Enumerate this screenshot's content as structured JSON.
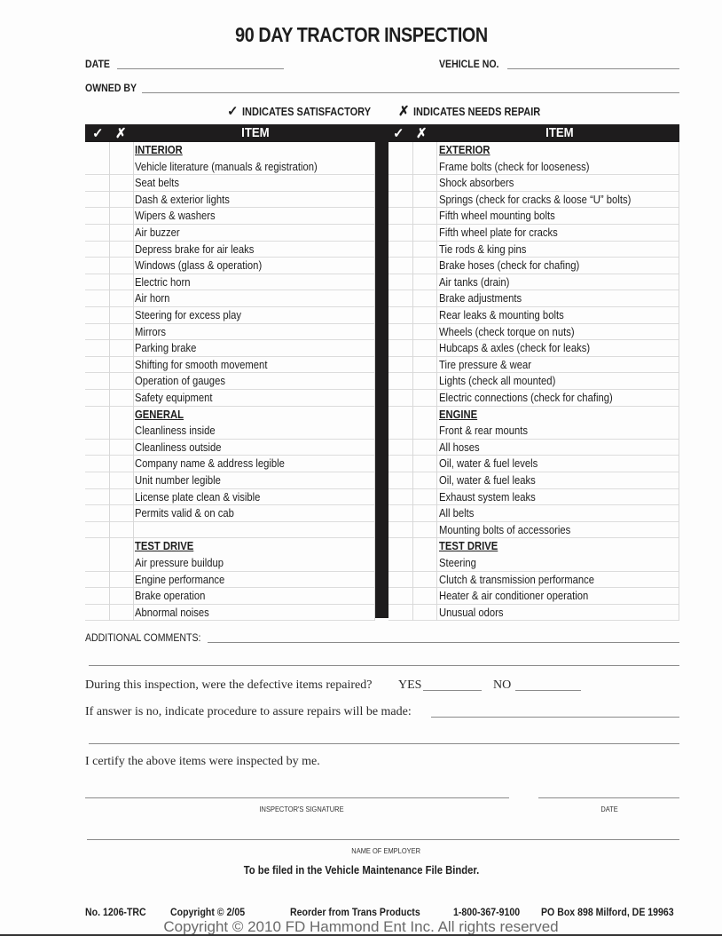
{
  "form": {
    "title": "90 DAY TRACTOR INSPECTION",
    "date_label": "DATE",
    "date_value": "",
    "vehicle_no_label": "VEHICLE NO.",
    "vehicle_no_value": "",
    "owned_by_label": "OWNED BY",
    "owned_by_value": ""
  },
  "legend": {
    "satisfactory_icon": "check-icon",
    "satisfactory_symbol": "✓",
    "satisfactory_label": "INDICATES SATISFACTORY",
    "repair_icon": "x-icon",
    "repair_symbol": "✗",
    "repair_label": "INDICATES NEEDS REPAIR"
  },
  "table": {
    "header": {
      "check_symbol": "✓",
      "x_symbol": "✗",
      "item_label": "ITEM"
    },
    "left_column": [
      {
        "text": "INTERIOR",
        "section": true
      },
      {
        "text": "Vehicle literature (manuals & registration)",
        "section": false
      },
      {
        "text": "Seat belts",
        "section": false
      },
      {
        "text": "Dash & exterior lights",
        "section": false
      },
      {
        "text": "Wipers & washers",
        "section": false
      },
      {
        "text": "Air buzzer",
        "section": false
      },
      {
        "text": "Depress brake for air leaks",
        "section": false
      },
      {
        "text": "Windows (glass & operation)",
        "section": false
      },
      {
        "text": "Electric horn",
        "section": false
      },
      {
        "text": "Air horn",
        "section": false
      },
      {
        "text": "Steering for excess play",
        "section": false
      },
      {
        "text": "Mirrors",
        "section": false
      },
      {
        "text": "Parking brake",
        "section": false
      },
      {
        "text": "Shifting for smooth movement",
        "section": false
      },
      {
        "text": "Operation of gauges",
        "section": false
      },
      {
        "text": "Safety equipment",
        "section": false
      },
      {
        "text": "GENERAL",
        "section": true
      },
      {
        "text": "Cleanliness inside",
        "section": false
      },
      {
        "text": "Cleanliness outside",
        "section": false
      },
      {
        "text": "Company name & address legible",
        "section": false
      },
      {
        "text": "Unit number legible",
        "section": false
      },
      {
        "text": "License plate clean & visible",
        "section": false
      },
      {
        "text": "Permits valid & on cab",
        "section": false
      },
      {
        "text": "",
        "section": false
      },
      {
        "text": "TEST DRIVE",
        "section": true
      },
      {
        "text": "Air pressure buildup",
        "section": false
      },
      {
        "text": "Engine performance",
        "section": false
      },
      {
        "text": "Brake operation",
        "section": false
      },
      {
        "text": "Abnormal noises",
        "section": false
      }
    ],
    "right_column": [
      {
        "text": "EXTERIOR",
        "section": true
      },
      {
        "text": "Frame bolts (check for looseness)",
        "section": false
      },
      {
        "text": "Shock absorbers",
        "section": false
      },
      {
        "text": "Springs (check for cracks & loose “U” bolts)",
        "section": false
      },
      {
        "text": "Fifth wheel mounting bolts",
        "section": false
      },
      {
        "text": "Fifth wheel plate for cracks",
        "section": false
      },
      {
        "text": "Tie rods & king pins",
        "section": false
      },
      {
        "text": "Brake hoses (check for chafing)",
        "section": false
      },
      {
        "text": "Air tanks (drain)",
        "section": false
      },
      {
        "text": "Brake adjustments",
        "section": false
      },
      {
        "text": "Rear leaks & mounting bolts",
        "section": false
      },
      {
        "text": "Wheels (check torque on nuts)",
        "section": false
      },
      {
        "text": "Hubcaps & axles (check for leaks)",
        "section": false
      },
      {
        "text": "Tire pressure & wear",
        "section": false
      },
      {
        "text": "Lights (check all mounted)",
        "section": false
      },
      {
        "text": "Electric connections (check for chafing)",
        "section": false
      },
      {
        "text": "ENGINE",
        "section": true
      },
      {
        "text": "Front & rear mounts",
        "section": false
      },
      {
        "text": "All hoses",
        "section": false
      },
      {
        "text": "Oil, water & fuel levels",
        "section": false
      },
      {
        "text": "Oil, water & fuel leaks",
        "section": false
      },
      {
        "text": "Exhaust system leaks",
        "section": false
      },
      {
        "text": "All belts",
        "section": false
      },
      {
        "text": "Mounting bolts of accessories",
        "section": false
      },
      {
        "text": "TEST DRIVE",
        "section": true
      },
      {
        "text": "Steering",
        "section": false
      },
      {
        "text": "Clutch & transmission performance",
        "section": false
      },
      {
        "text": "Heater & air conditioner operation",
        "section": false
      },
      {
        "text": "Unusual odors",
        "section": false
      }
    ]
  },
  "comments": {
    "label": "ADDITIONAL COMMENTS:",
    "value": ""
  },
  "repair_question": {
    "text": "During this inspection, were the defective items repaired?",
    "yes_label": "YES",
    "no_label": "NO"
  },
  "procedure": {
    "text": "If answer is no, indicate procedure to assure repairs will be made:",
    "value": ""
  },
  "certify": {
    "text": "I certify the above items were inspected by me."
  },
  "signature": {
    "inspector_label": "INSPECTOR'S SIGNATURE",
    "date_label": "DATE",
    "employer_label": "NAME OF EMPLOYER"
  },
  "filing_note": "To be filed in the Vehicle Maintenance File Binder.",
  "footer": {
    "form_no": "No. 1206-TRC",
    "copyright": "Copyright © 2/05",
    "reorder": "Reorder from Trans Products",
    "phone": "1-800-367-9100",
    "address": "PO Box 898 Milford, DE 19963"
  },
  "watermark": "Copyright © 2010 FD Hammond Ent Inc. All rights reserved"
}
